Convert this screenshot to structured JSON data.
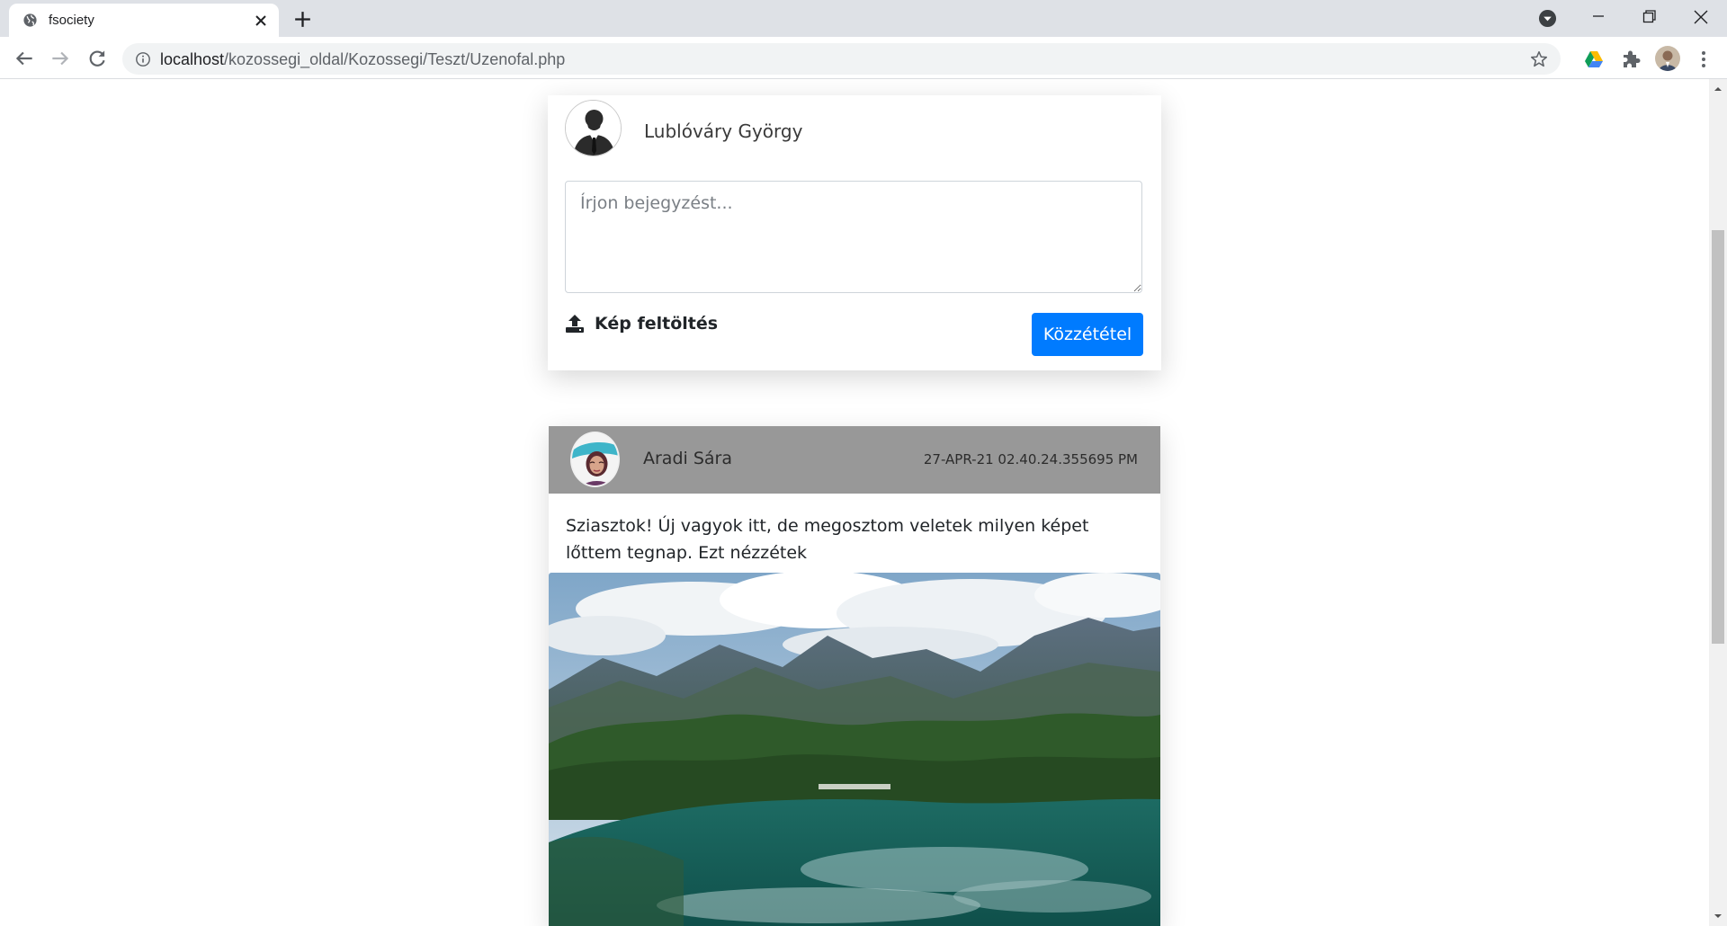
{
  "browser": {
    "tab_title": "fsociety",
    "url_host": "localhost",
    "url_path": "/kozossegi_oldal/Kozossegi/Teszt/Uzenofal.php"
  },
  "composer": {
    "user_name": "Lublóváry György",
    "placeholder": "Írjon bejegyzést...",
    "upload_label": "Kép feltöltés",
    "publish_label": "Közzététel"
  },
  "post": {
    "author": "Aradi Sára",
    "timestamp": "27-APR-21 02.40.24.355695 PM",
    "text": "Sziasztok! Új vagyok itt, de megosztom veletek milyen képet lőttem tegnap. Ezt nézzétek"
  },
  "colors": {
    "accent": "#007bff",
    "post_header": "#989898",
    "tabstrip": "#dee1e6"
  },
  "icons": [
    "globe-icon",
    "close-icon",
    "plus-icon",
    "back-icon",
    "forward-icon",
    "reload-icon",
    "info-icon",
    "star-icon",
    "drive-icon",
    "puzzle-icon",
    "menu-icon",
    "upload-icon"
  ]
}
